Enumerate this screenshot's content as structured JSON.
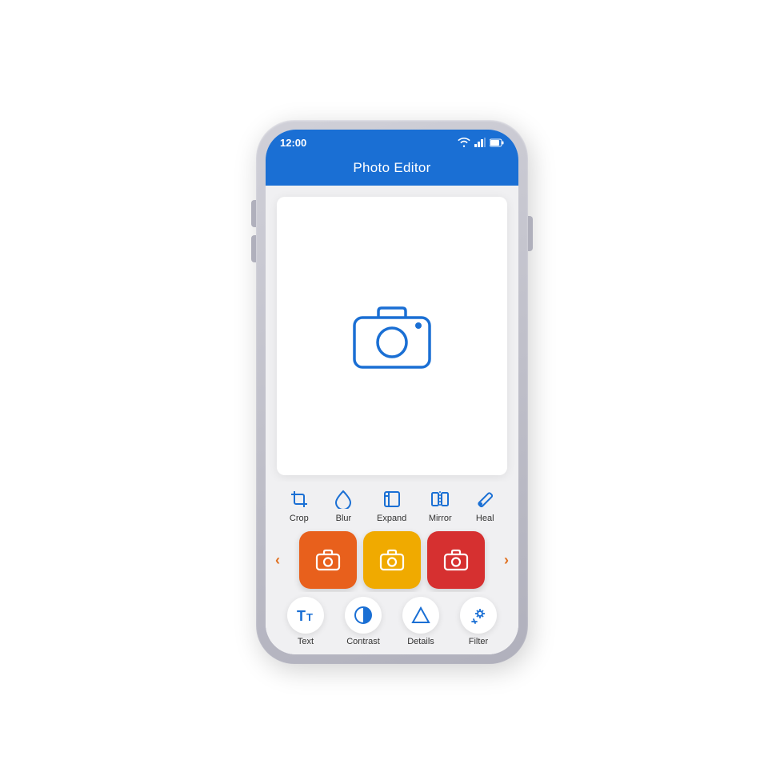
{
  "phone": {
    "status": {
      "time": "12:00"
    },
    "header": {
      "title": "Photo Editor"
    },
    "tools": [
      {
        "id": "crop",
        "label": "Crop",
        "icon": "crop"
      },
      {
        "id": "blur",
        "label": "Blur",
        "icon": "droplet"
      },
      {
        "id": "expand",
        "label": "Expand",
        "icon": "expand"
      },
      {
        "id": "mirror",
        "label": "Mirror",
        "icon": "mirror"
      },
      {
        "id": "heal",
        "label": "Heal",
        "icon": "wand"
      }
    ],
    "filters": [
      {
        "id": "orange",
        "color": "#e8601c"
      },
      {
        "id": "yellow",
        "color": "#f0aa00"
      },
      {
        "id": "red",
        "color": "#d63030"
      }
    ],
    "bottomTools": [
      {
        "id": "text",
        "label": "Text",
        "icon": "text"
      },
      {
        "id": "contrast",
        "label": "Contrast",
        "icon": "contrast"
      },
      {
        "id": "details",
        "label": "Details",
        "icon": "triangle"
      },
      {
        "id": "filter",
        "label": "Filter",
        "icon": "sparkle"
      }
    ],
    "arrows": {
      "left": "‹",
      "right": "›"
    }
  }
}
